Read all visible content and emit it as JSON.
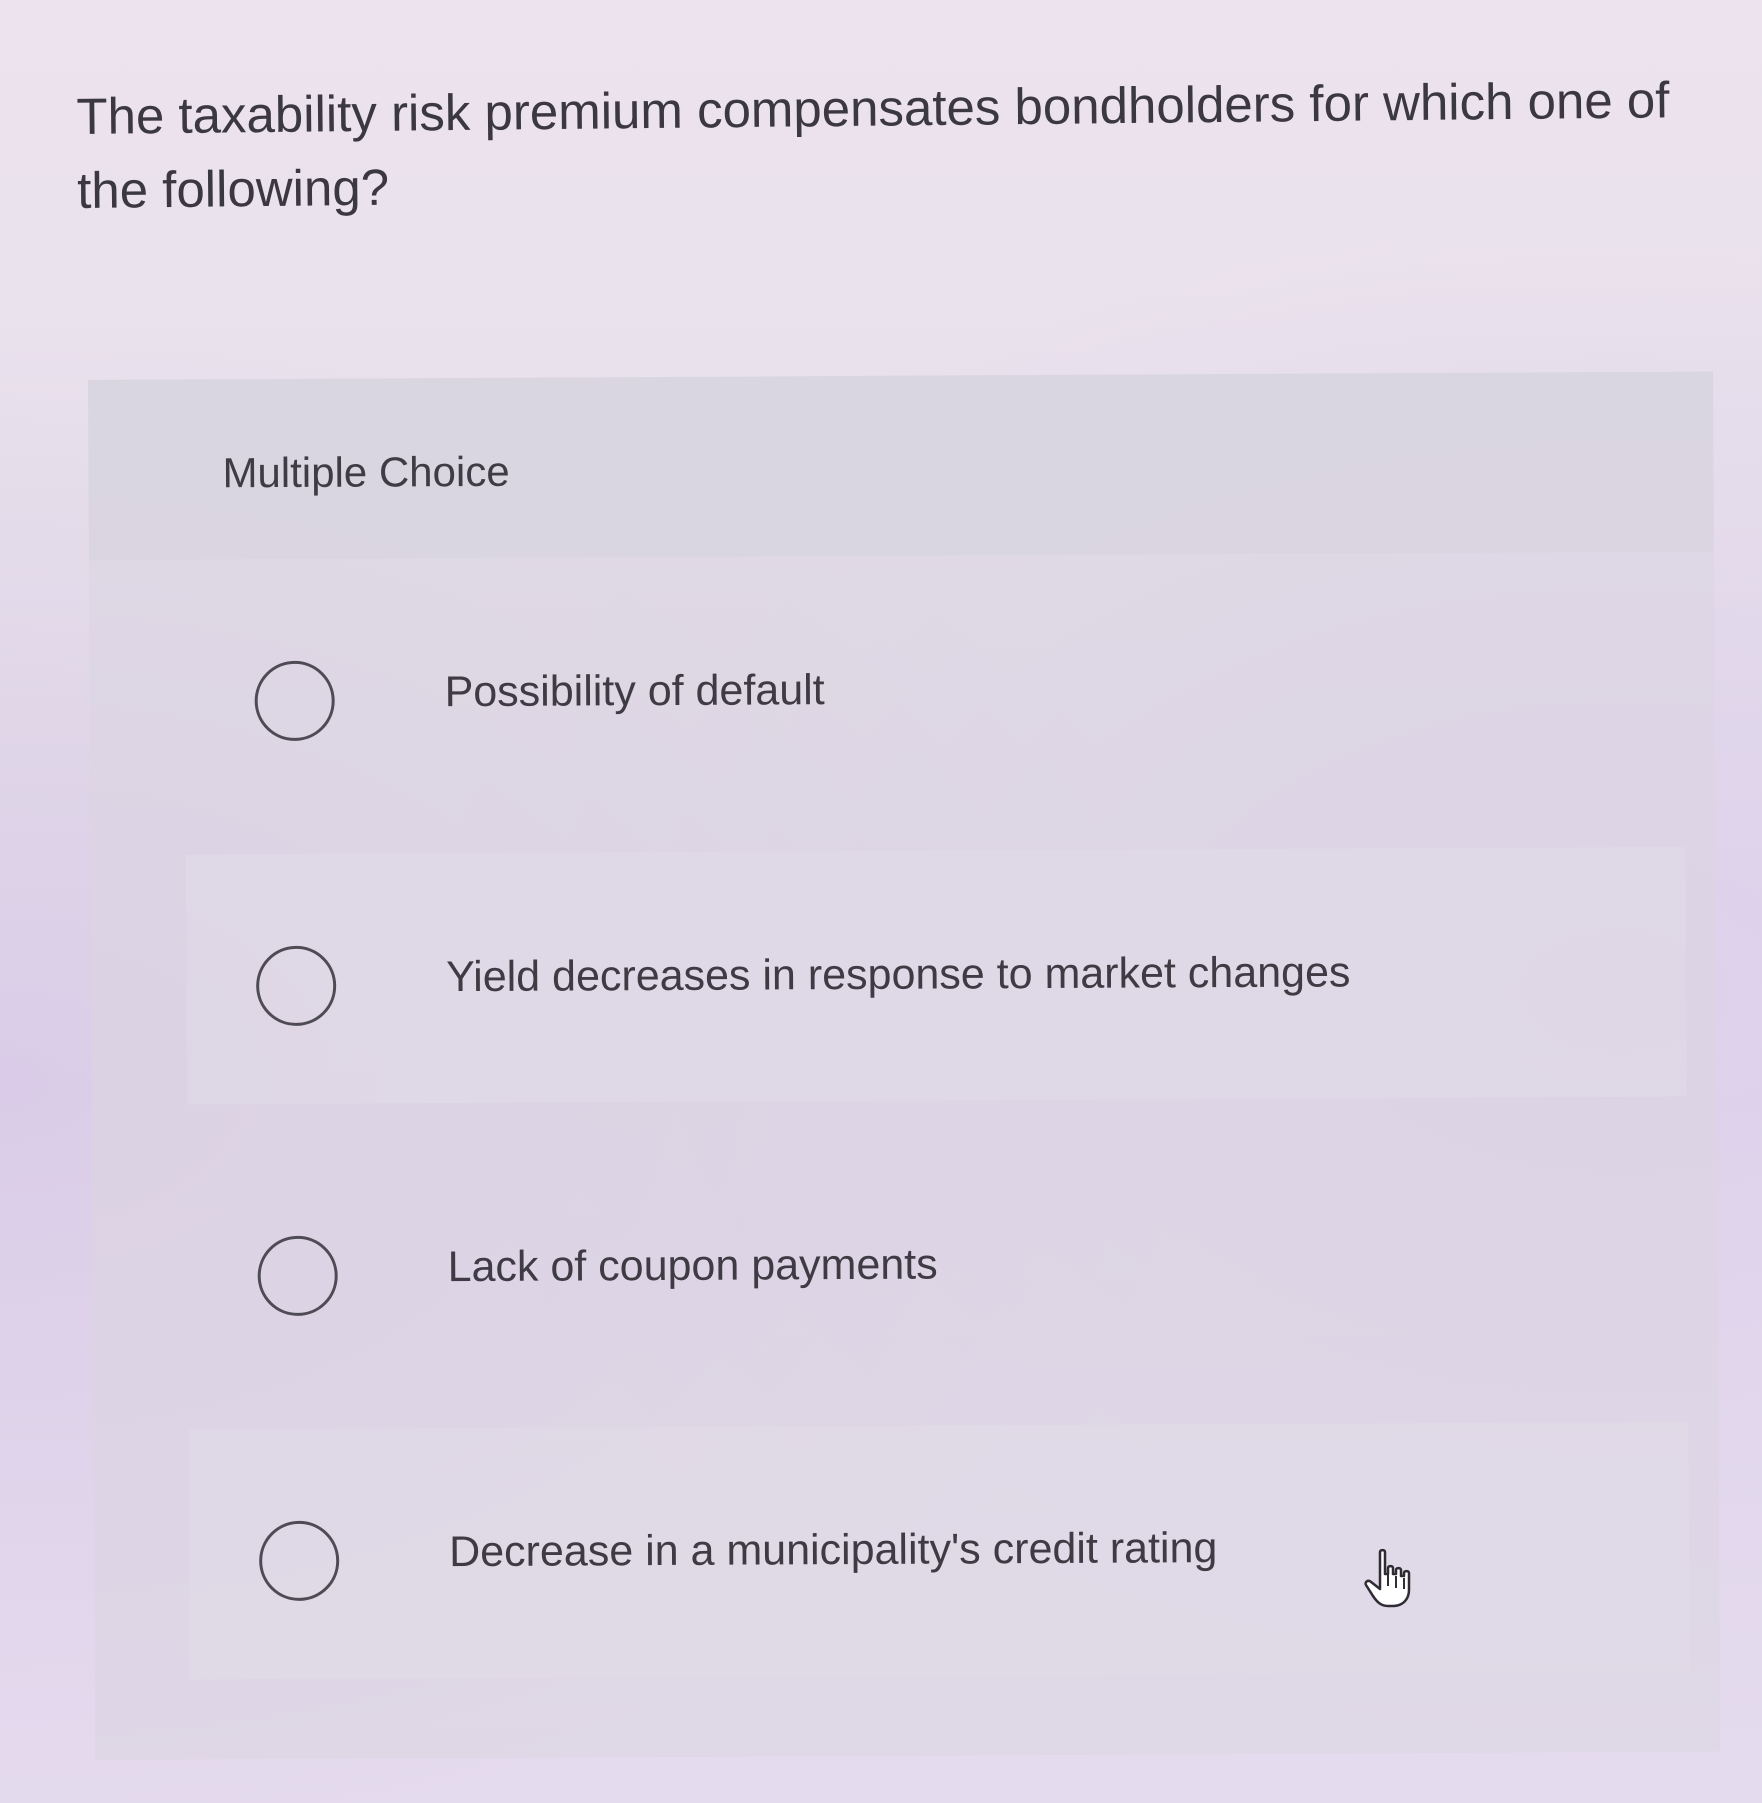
{
  "question": {
    "text": "The taxability risk premium compensates bondholders for which one of the following?"
  },
  "multiple_choice": {
    "label": "Multiple Choice",
    "options": [
      {
        "label": "Possibility of default",
        "selected": false
      },
      {
        "label": "Yield decreases in response to market changes",
        "selected": false
      },
      {
        "label": "Lack of coupon payments",
        "selected": false
      },
      {
        "label": "Decrease in a municipality's credit rating",
        "selected": false
      }
    ]
  },
  "cursor": {
    "icon": "hand-pointer-icon"
  }
}
